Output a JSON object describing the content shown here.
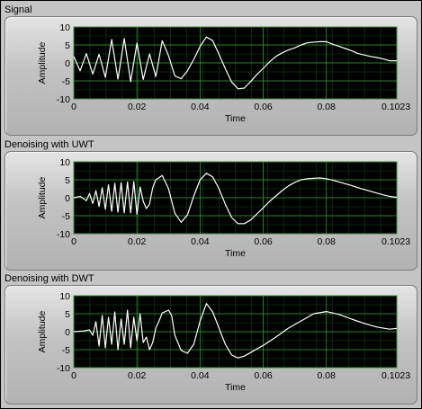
{
  "chart_data": [
    {
      "type": "line",
      "title": "Signal",
      "xlabel": "Time",
      "ylabel": "Amplitude",
      "xlim": [
        0,
        0.1023
      ],
      "ylim": [
        -10,
        10
      ],
      "x_ticks": [
        "0",
        "0.02",
        "0.04",
        "0.06",
        "0.08",
        "0.1023"
      ],
      "y_ticks": [
        "10",
        "5",
        "0",
        "-5",
        "-10"
      ],
      "grid": true,
      "series": [
        {
          "line_color": "#ffffff",
          "x": [
            0,
            0.002,
            0.004,
            0.006,
            0.008,
            0.01,
            0.012,
            0.014,
            0.016,
            0.018,
            0.02,
            0.022,
            0.024,
            0.026,
            0.028,
            0.03,
            0.032,
            0.034,
            0.036,
            0.038,
            0.04,
            0.042,
            0.044,
            0.046,
            0.048,
            0.05,
            0.052,
            0.054,
            0.056,
            0.058,
            0.06,
            0.062,
            0.064,
            0.066,
            0.068,
            0.07,
            0.072,
            0.074,
            0.076,
            0.078,
            0.08,
            0.082,
            0.084,
            0.086,
            0.088,
            0.09,
            0.092,
            0.094,
            0.096,
            0.098,
            0.1,
            0.1023
          ],
          "y": [
            1.8,
            -2.2,
            2.6,
            -3.1,
            2.4,
            -4.0,
            6.5,
            -4.5,
            6.8,
            -5.2,
            5.5,
            -4.6,
            2.5,
            -3.8,
            6.2,
            2.0,
            -3.6,
            -4.4,
            -2.2,
            1.0,
            4.6,
            7.2,
            6.2,
            2.4,
            -1.6,
            -5.3,
            -7.2,
            -7.0,
            -5.2,
            -3.2,
            -1.5,
            0.3,
            1.8,
            2.8,
            3.6,
            4.2,
            5.0,
            5.6,
            5.8,
            5.9,
            5.9,
            5.2,
            4.6,
            4.0,
            3.4,
            2.6,
            2.2,
            1.8,
            1.5,
            1.1,
            0.6,
            0.6
          ]
        }
      ]
    },
    {
      "type": "line",
      "title": "Denoising with UWT",
      "xlabel": "Time",
      "ylabel": "Amplitude",
      "xlim": [
        0,
        0.1023
      ],
      "ylim": [
        -10,
        10
      ],
      "x_ticks": [
        "0",
        "0.02",
        "0.04",
        "0.06",
        "0.08",
        "0.1023"
      ],
      "y_ticks": [
        "10",
        "5",
        "0",
        "-5",
        "-10"
      ],
      "grid": true,
      "series": [
        {
          "line_color": "#ffffff",
          "x": [
            0,
            0.002,
            0.004,
            0.005,
            0.006,
            0.007,
            0.008,
            0.009,
            0.01,
            0.011,
            0.012,
            0.013,
            0.014,
            0.015,
            0.016,
            0.017,
            0.018,
            0.019,
            0.02,
            0.021,
            0.022,
            0.023,
            0.024,
            0.025,
            0.026,
            0.028,
            0.03,
            0.032,
            0.034,
            0.036,
            0.038,
            0.04,
            0.042,
            0.044,
            0.046,
            0.048,
            0.05,
            0.052,
            0.054,
            0.056,
            0.058,
            0.06,
            0.062,
            0.064,
            0.066,
            0.068,
            0.07,
            0.072,
            0.074,
            0.076,
            0.078,
            0.08,
            0.082,
            0.084,
            0.086,
            0.088,
            0.09,
            0.092,
            0.094,
            0.096,
            0.098,
            0.1,
            0.1023
          ],
          "y": [
            0,
            0.4,
            -0.8,
            1.2,
            -1.6,
            2.0,
            -2.4,
            2.8,
            -3.2,
            3.6,
            -3.8,
            4.0,
            -4.0,
            4.2,
            -4.2,
            4.4,
            -4.2,
            4.5,
            -4.6,
            3.0,
            -1.0,
            -3.0,
            -1.8,
            2.8,
            5.0,
            6.2,
            2.5,
            -4.3,
            -6.8,
            -4.8,
            0.5,
            5.0,
            6.8,
            5.8,
            2.5,
            -1.8,
            -5.5,
            -7.2,
            -7.2,
            -6.2,
            -4.5,
            -2.8,
            -1.0,
            0.5,
            2.0,
            3.3,
            4.3,
            5.0,
            5.3,
            5.4,
            5.5,
            5.3,
            4.9,
            4.4,
            3.9,
            3.4,
            2.8,
            2.3,
            1.8,
            1.3,
            0.8,
            0.4,
            0.1
          ]
        }
      ]
    },
    {
      "type": "line",
      "title": "Denoising with DWT",
      "xlabel": "Time",
      "ylabel": "Amplitude",
      "xlim": [
        0,
        0.1023
      ],
      "ylim": [
        -10,
        10
      ],
      "x_ticks": [
        "0",
        "0.02",
        "0.04",
        "0.06",
        "0.08",
        "0.1023"
      ],
      "y_ticks": [
        "10",
        "5",
        "0",
        "-5",
        "-10"
      ],
      "grid": true,
      "series": [
        {
          "line_color": "#ffffff",
          "x": [
            0,
            0.003,
            0.005,
            0.006,
            0.007,
            0.008,
            0.009,
            0.01,
            0.011,
            0.012,
            0.013,
            0.014,
            0.015,
            0.016,
            0.017,
            0.018,
            0.019,
            0.02,
            0.021,
            0.022,
            0.023,
            0.024,
            0.025,
            0.026,
            0.027,
            0.028,
            0.03,
            0.031,
            0.032,
            0.034,
            0.036,
            0.038,
            0.04,
            0.042,
            0.044,
            0.046,
            0.048,
            0.05,
            0.052,
            0.054,
            0.056,
            0.06,
            0.064,
            0.068,
            0.072,
            0.076,
            0.08,
            0.084,
            0.088,
            0.092,
            0.096,
            0.1,
            0.1023
          ],
          "y": [
            0,
            0.2,
            0.5,
            -1.0,
            2.8,
            -4.0,
            4.5,
            -4.5,
            4.0,
            -3.5,
            5.5,
            -5.0,
            3.5,
            -3.5,
            6.0,
            -4.5,
            4.0,
            -2.5,
            5.0,
            -3.0,
            -1.5,
            -5.0,
            -3.0,
            1.0,
            3.0,
            5.2,
            6.0,
            4.5,
            -1.0,
            -5.2,
            -6.0,
            -3.5,
            3.0,
            7.8,
            5.5,
            1.0,
            -3.5,
            -6.5,
            -7.3,
            -6.8,
            -5.8,
            -3.8,
            -1.5,
            1.0,
            3.0,
            5.0,
            5.6,
            4.8,
            3.5,
            2.3,
            1.3,
            0.7,
            0.9
          ]
        }
      ]
    }
  ]
}
